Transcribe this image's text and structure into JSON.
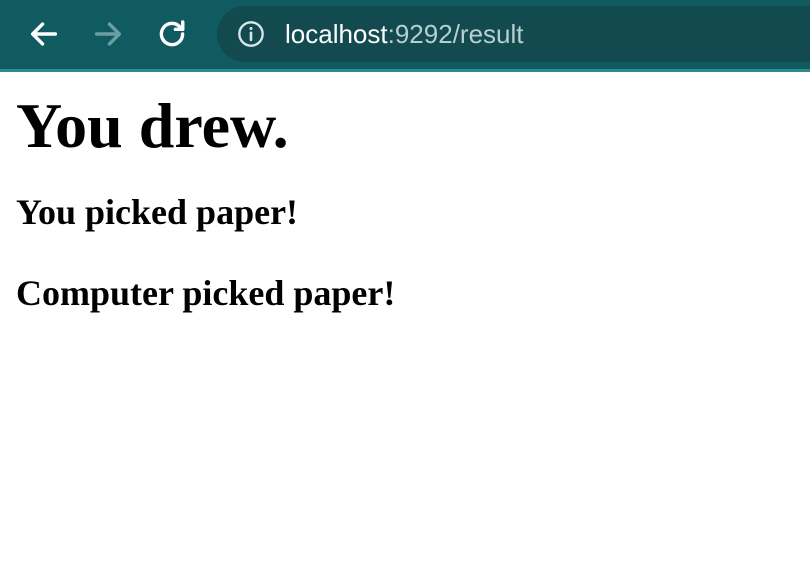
{
  "browser": {
    "url_host": "localhost",
    "url_path": ":9292/result",
    "icons": {
      "back": "back-arrow-icon",
      "forward": "forward-arrow-icon",
      "reload": "reload-icon",
      "site_info": "info-icon"
    },
    "colors": {
      "toolbar": "#0f5b60",
      "omnibox": "#124a4f",
      "forward_disabled": "#6b9ea2"
    }
  },
  "page": {
    "heading": "You drew.",
    "user_choice": "You picked paper!",
    "computer_choice": "Computer picked paper!"
  }
}
